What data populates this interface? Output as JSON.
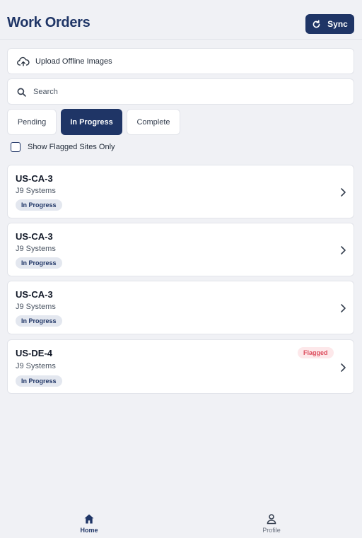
{
  "header": {
    "title": "Work Orders",
    "sync_label": "Sync"
  },
  "upload": {
    "label": "Upload Offline Images"
  },
  "search": {
    "placeholder": "Search",
    "value": ""
  },
  "tabs": [
    {
      "label": "Pending",
      "active": false
    },
    {
      "label": "In Progress",
      "active": true
    },
    {
      "label": "Complete",
      "active": false
    }
  ],
  "filter": {
    "label": "Show Flagged Sites Only",
    "checked": false
  },
  "work_orders": [
    {
      "site": "US-CA-3",
      "company": "J9 Systems",
      "status": "In Progress",
      "flag": ""
    },
    {
      "site": "US-CA-3",
      "company": "J9 Systems",
      "status": "In Progress",
      "flag": ""
    },
    {
      "site": "US-CA-3",
      "company": "J9 Systems",
      "status": "In Progress",
      "flag": ""
    },
    {
      "site": "US-DE-4",
      "company": "J9 Systems",
      "status": "In Progress",
      "flag": "Flagged"
    }
  ],
  "nav": [
    {
      "label": "Home",
      "icon": "home-icon",
      "active": true
    },
    {
      "label": "Profile",
      "icon": "user-icon",
      "active": false
    }
  ],
  "colors": {
    "primary": "#1f3566",
    "background": "#f0f1f5",
    "flag_text": "#dc4b5c",
    "flag_bg": "#fde8ea",
    "status_bg": "#e3e7ef"
  }
}
